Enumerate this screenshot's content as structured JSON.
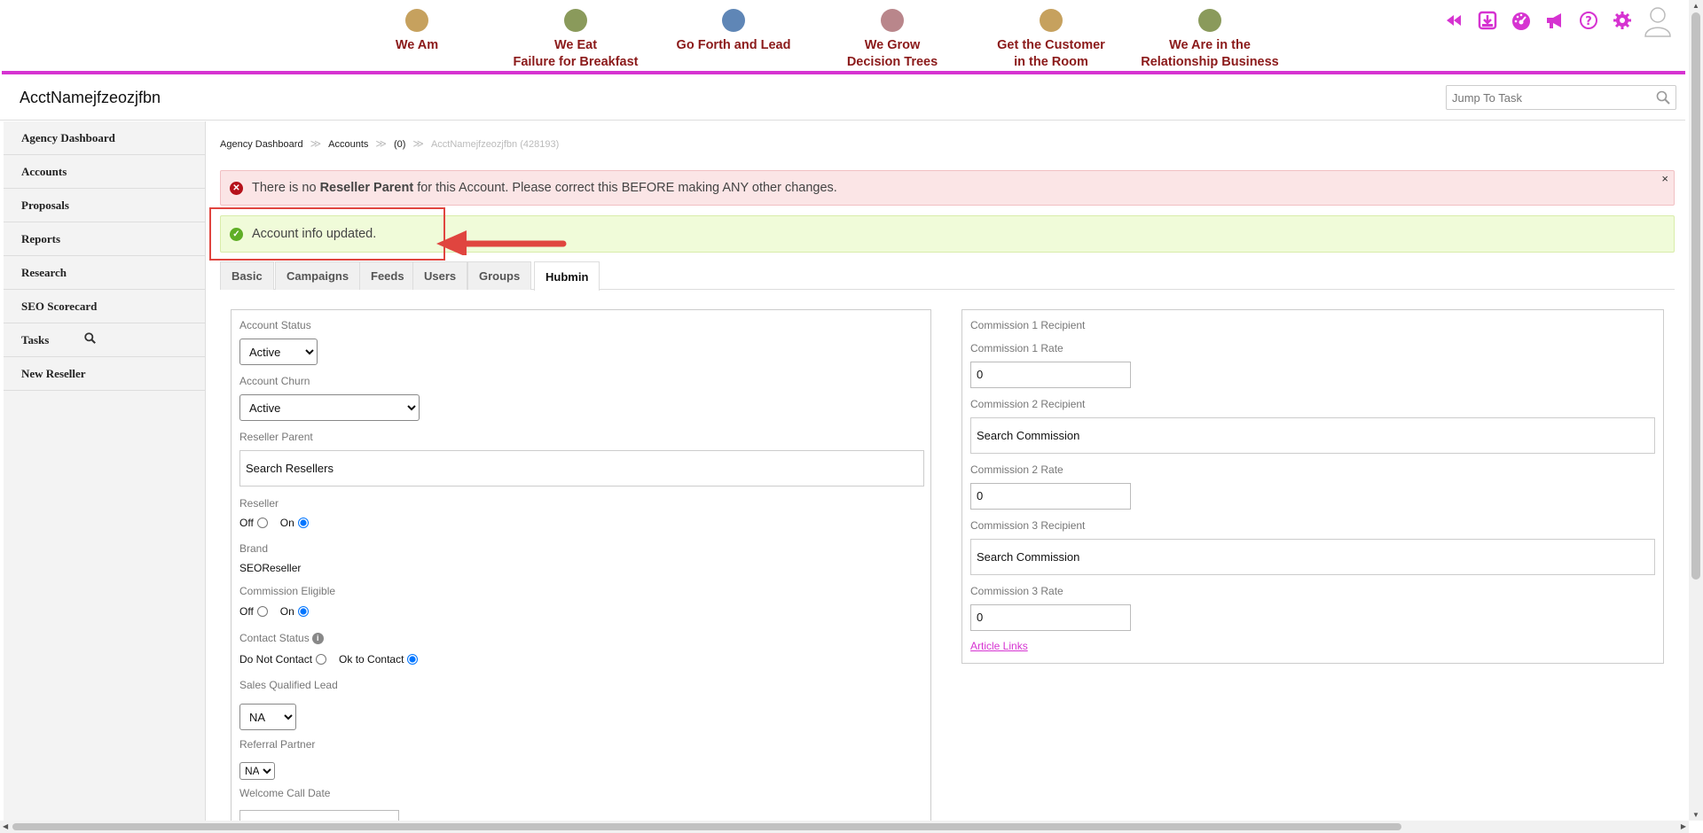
{
  "topnav": {
    "items": [
      {
        "label": "We Am",
        "color": "#c6a15e"
      },
      {
        "label": "We Eat\nFailure for Breakfast",
        "color": "#8a9a5b"
      },
      {
        "label": "Go Forth and Lead",
        "color": "#5f86b6"
      },
      {
        "label": "We Grow\nDecision Trees",
        "color": "#b9868b"
      },
      {
        "label": "Get the Customer\nin the Room",
        "color": "#c6a15e"
      },
      {
        "label": "We Are in the\nRelationship Business",
        "color": "#8a9a5b"
      }
    ],
    "accent_color": "#d633d1",
    "icons": [
      "rewind-icon",
      "download-icon",
      "dashboard-icon",
      "megaphone-icon",
      "help-icon",
      "gear-icon"
    ]
  },
  "header": {
    "account_name": "AcctNamejfzeozjfbn",
    "jump_placeholder": "Jump To Task"
  },
  "sidebar": {
    "items": [
      "Agency Dashboard",
      "Accounts",
      "Proposals",
      "Reports",
      "Research",
      "SEO Scorecard",
      "Tasks",
      "New Reseller"
    ]
  },
  "breadcrumb": {
    "items": [
      "Agency Dashboard",
      "Accounts",
      "(0)"
    ],
    "current": "AcctNamejfzeozjfbn (428193)"
  },
  "alerts": {
    "error_pre": "There is no ",
    "error_bold": "Reseller Parent",
    "error_post": " for this Account. Please correct this BEFORE making ANY other changes.",
    "close": "×",
    "success": "Account info updated."
  },
  "tabs": [
    "Basic",
    "Campaigns",
    "Feeds",
    "Users",
    "Groups",
    "Hubmin"
  ],
  "active_tab": "Hubmin",
  "left_form": {
    "account_status_label": "Account Status",
    "account_status_value": "Active",
    "account_churn_label": "Account Churn",
    "account_churn_value": "Active",
    "reseller_parent_label": "Reseller Parent",
    "reseller_parent_value": "Search Resellers",
    "reseller_label": "Reseller",
    "off": "Off",
    "on": "On",
    "brand_label": "Brand",
    "brand_value": "SEOReseller",
    "commission_eligible_label": "Commission Eligible",
    "contact_status_label": "Contact Status",
    "do_not_contact": "Do Not Contact",
    "ok_to_contact": "Ok to Contact",
    "sql_label": "Sales Qualified Lead",
    "sql_value": "NA",
    "referral_label": "Referral Partner",
    "referral_value": "NA",
    "welcome_label": "Welcome Call Date"
  },
  "right_form": {
    "c1_recipient_label": "Commission 1 Recipient",
    "c1_rate_label": "Commission 1 Rate",
    "c1_rate_value": "0",
    "c2_recipient_label": "Commission 2 Recipient",
    "c2_recipient_value": "Search Commission",
    "c2_rate_label": "Commission 2 Rate",
    "c2_rate_value": "0",
    "c3_recipient_label": "Commission 3 Recipient",
    "c3_recipient_value": "Search Commission",
    "c3_rate_label": "Commission 3 Rate",
    "c3_rate_value": "0",
    "article_links": "Article Links"
  }
}
